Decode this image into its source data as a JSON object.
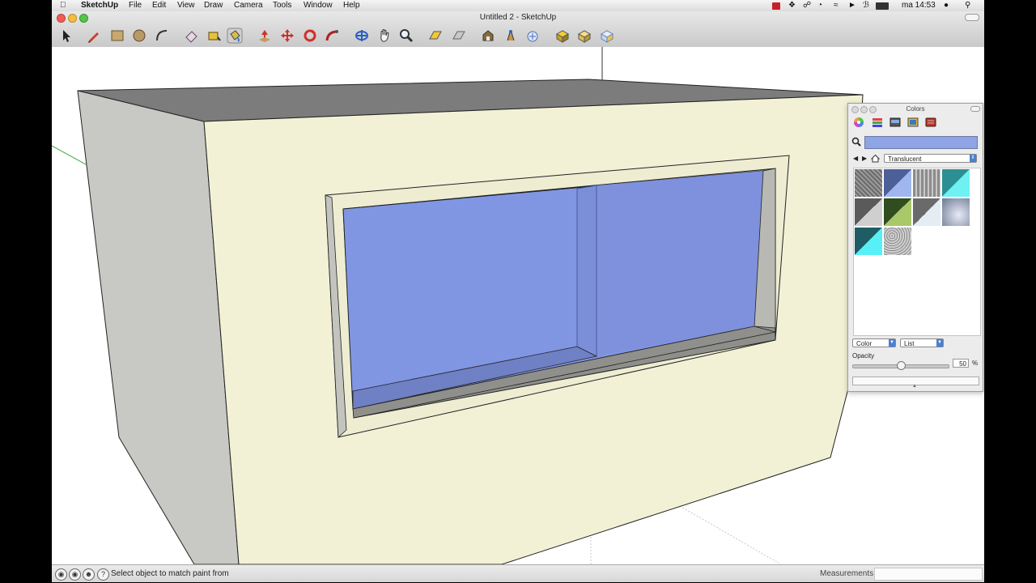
{
  "menubar": {
    "app_name": "SketchUp",
    "items": [
      "File",
      "Edit",
      "View",
      "Draw",
      "Camera",
      "Tools",
      "Window",
      "Help"
    ],
    "clock": "ma 14:53"
  },
  "window": {
    "title": "Untitled 2 - SketchUp"
  },
  "toolbar": {
    "tools": [
      "select-tool",
      "pencil-tool",
      "rectangle-tool",
      "circle-tool",
      "arc-tool",
      "eraser-tool",
      "tape-measure-tool",
      "paint-bucket-tool",
      "push-pull-tool",
      "move-tool",
      "rotate-tool",
      "follow-me-tool",
      "orbit-tool",
      "pan-tool",
      "zoom-tool",
      "section-plane-tool",
      "section-display-tool",
      "warehouse-tool",
      "component-tool",
      "share-tool",
      "extension-tool",
      "layout-tool",
      "style-tool"
    ]
  },
  "colors_panel": {
    "title": "Colors",
    "library": "Translucent",
    "color_mode": "Color",
    "view_mode": "List",
    "opacity_label": "Opacity",
    "opacity_value": "50",
    "opacity_unit": "%",
    "opacity_fraction": 0.5,
    "selected_color": "#8ea4e4"
  },
  "statusbar": {
    "message": "Select object to match paint from",
    "measurements_label": "Measurements"
  }
}
